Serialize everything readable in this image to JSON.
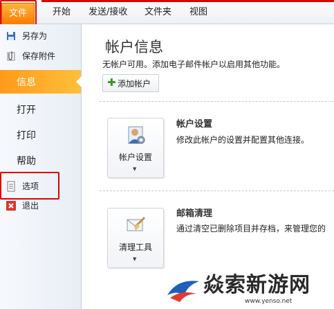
{
  "tabs": {
    "file": "文件",
    "items": [
      "开始",
      "发送/接收",
      "文件夹",
      "视图"
    ]
  },
  "leftnav": {
    "save_as": "另存为",
    "save_attachments": "保存附件",
    "info": "信息",
    "open": "打开",
    "print": "打印",
    "help": "帮助",
    "options": "选项",
    "exit": "退出"
  },
  "main": {
    "title": "帐户信息",
    "subtitle": "无帐户可用。添加电子邮件帐户以启用其他功能。",
    "add_account": "添加帐户",
    "account_settings": {
      "button": "帐户设置",
      "title": "帐户设置",
      "desc": "修改此帐户的设置并配置其他连接。"
    },
    "mailbox_cleanup": {
      "button": "清理工具",
      "title": "邮箱清理",
      "desc": "通过清空已删除项目并存档，来管理您的"
    }
  },
  "watermark": {
    "text": "焱索新游网",
    "url": "www.yenso.net"
  },
  "colors": {
    "accent_orange": "#ff8c00",
    "highlight_red": "#e00000"
  }
}
